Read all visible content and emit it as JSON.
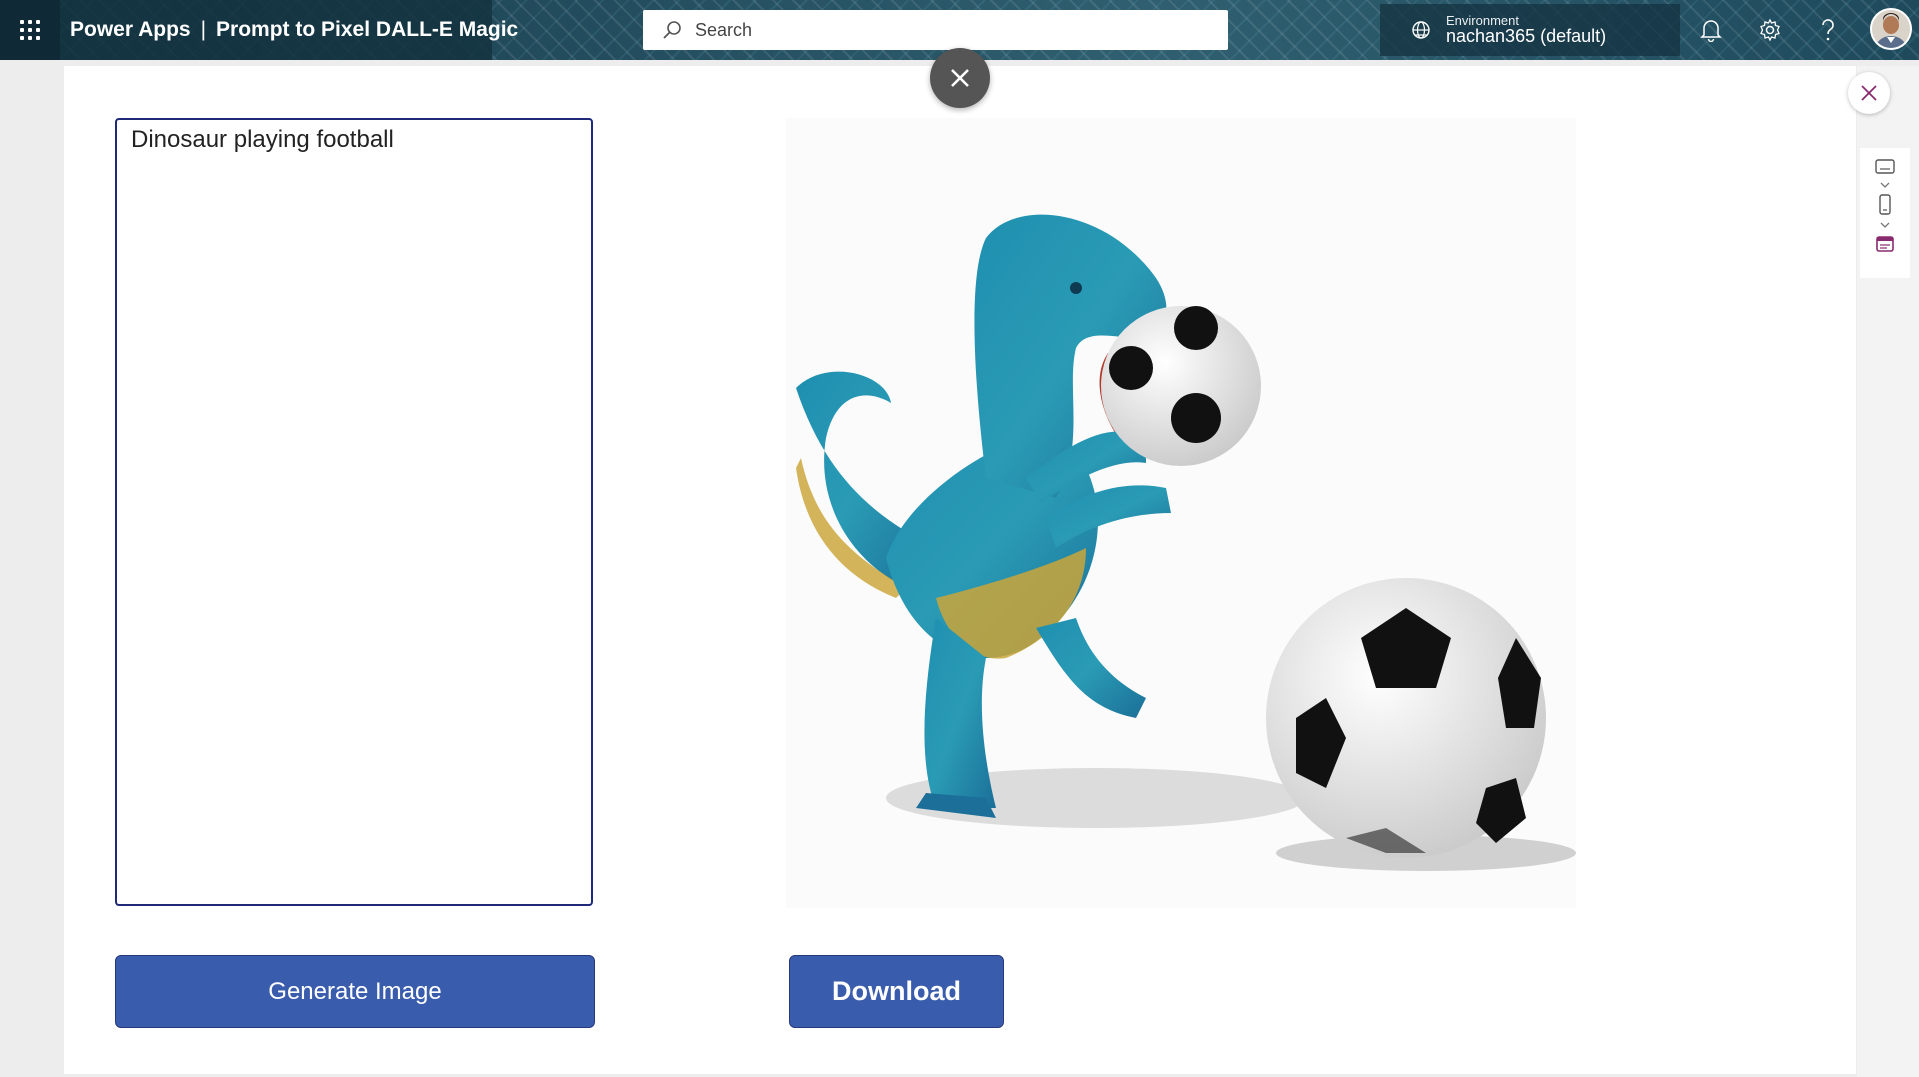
{
  "header": {
    "app_name": "Power Apps",
    "separator": "|",
    "app_title": "Prompt to Pixel DALL-E Magic",
    "search_placeholder": "Search",
    "environment_label": "Environment",
    "environment_value": "nachan365 (default)",
    "icons": [
      "app-launcher-icon",
      "search-icon",
      "globe-icon",
      "bell-icon",
      "gear-icon",
      "help-icon",
      "avatar"
    ]
  },
  "main": {
    "prompt_text": "Dinosaur playing football",
    "generate_label": "Generate Image",
    "download_label": "Download",
    "image_subject": "dinosaur-football-illustration"
  },
  "rail": {
    "icons": [
      "close-icon",
      "screen-icon",
      "phone-icon",
      "calendar-icon"
    ]
  },
  "colors": {
    "accent": "#3a5cad",
    "prompt_border": "#1e2a78",
    "header_bg": "#1b3e4f"
  }
}
